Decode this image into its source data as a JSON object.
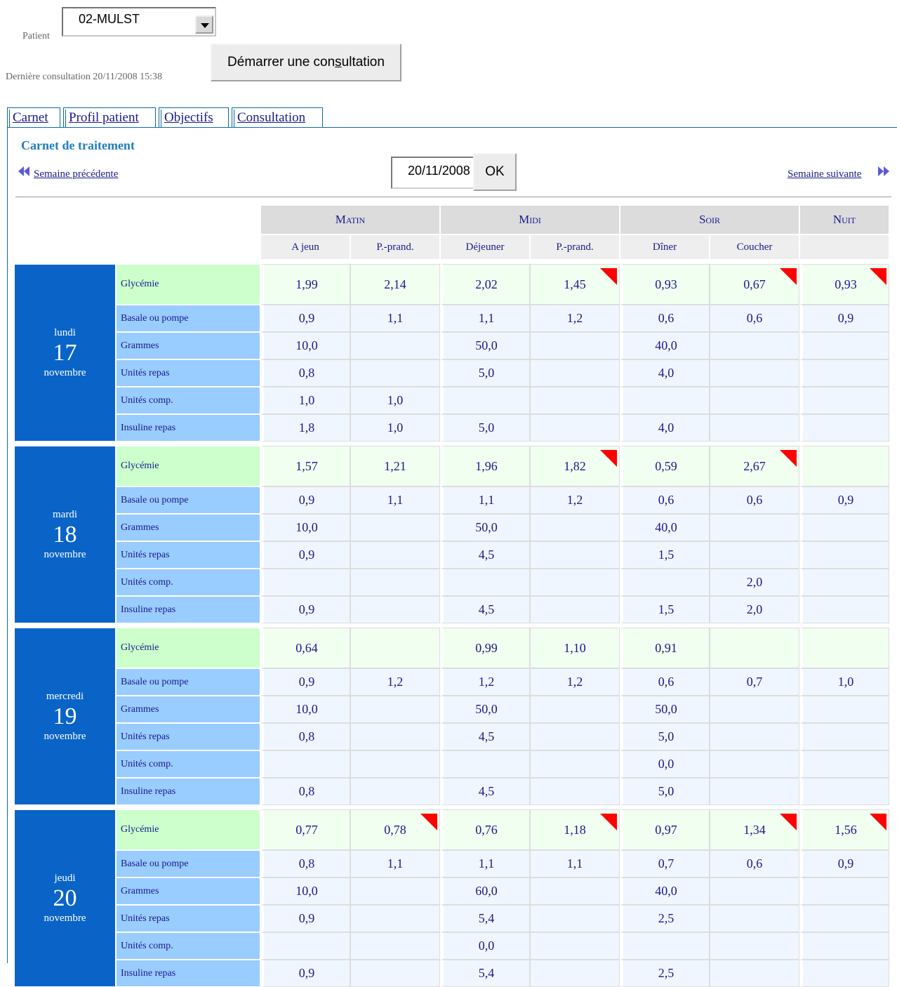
{
  "header": {
    "patient_label": "Patient",
    "patient_value": "02-MULST",
    "last_consultation": "Dernière consultation 20/11/2008 15:38",
    "start_button": "Démarrer une consultation"
  },
  "tabs": [
    "Carnet",
    "Profil patient",
    "Objectifs",
    "Consultation"
  ],
  "carnet": {
    "title": "Carnet de traitement",
    "prev_week": "Semaine précédente",
    "next_week": "Semaine suivante",
    "date_value": "20/11/2008",
    "ok_label": "OK"
  },
  "columns": {
    "groups": [
      "Matin",
      "Midi",
      "Soir",
      "Nuit"
    ],
    "subs": [
      "A jeun",
      "P.-prand.",
      "Déjeuner",
      "P.-prand.",
      "Dîner",
      "Coucher",
      ""
    ]
  },
  "row_labels": [
    "Glycémie",
    "Basale ou pompe",
    "Grammes",
    "Unités repas",
    "Unités comp.",
    "Insuline repas"
  ],
  "colors": {
    "day": "#0a64c8",
    "flag": "#ff0000",
    "glyc_label": "#ccffcc",
    "row_label": "#99ccff"
  },
  "days": [
    {
      "name": "lundi",
      "num": "17",
      "month": "novembre",
      "rows": [
        [
          "1,99",
          "2,14",
          "2,02",
          "1,45",
          "0,93",
          "0,67",
          "0,93"
        ],
        [
          "0,9",
          "1,1",
          "1,1",
          "1,2",
          "0,6",
          "0,6",
          "0,9"
        ],
        [
          "10,0",
          "",
          "50,0",
          "",
          "40,0",
          "",
          ""
        ],
        [
          "0,8",
          "",
          "5,0",
          "",
          "4,0",
          "",
          ""
        ],
        [
          "1,0",
          "1,0",
          "",
          "",
          "",
          "",
          ""
        ],
        [
          "1,8",
          "1,0",
          "5,0",
          "",
          "4,0",
          "",
          ""
        ]
      ],
      "flags": [
        false,
        false,
        false,
        true,
        false,
        true,
        true
      ]
    },
    {
      "name": "mardi",
      "num": "18",
      "month": "novembre",
      "rows": [
        [
          "1,57",
          "1,21",
          "1,96",
          "1,82",
          "0,59",
          "2,67",
          ""
        ],
        [
          "0,9",
          "1,1",
          "1,1",
          "1,2",
          "0,6",
          "0,6",
          "0,9"
        ],
        [
          "10,0",
          "",
          "50,0",
          "",
          "40,0",
          "",
          ""
        ],
        [
          "0,9",
          "",
          "4,5",
          "",
          "1,5",
          "",
          ""
        ],
        [
          "",
          "",
          "",
          "",
          "",
          "2,0",
          ""
        ],
        [
          "0,9",
          "",
          "4,5",
          "",
          "1,5",
          "2,0",
          ""
        ]
      ],
      "flags": [
        false,
        false,
        false,
        true,
        false,
        true,
        false
      ]
    },
    {
      "name": "mercredi",
      "num": "19",
      "month": "novembre",
      "rows": [
        [
          "0,64",
          "",
          "0,99",
          "1,10",
          "0,91",
          "",
          ""
        ],
        [
          "0,9",
          "1,2",
          "1,2",
          "1,2",
          "0,6",
          "0,7",
          "1,0"
        ],
        [
          "10,0",
          "",
          "50,0",
          "",
          "50,0",
          "",
          ""
        ],
        [
          "0,8",
          "",
          "4,5",
          "",
          "5,0",
          "",
          ""
        ],
        [
          "",
          "",
          "",
          "",
          "0,0",
          "",
          ""
        ],
        [
          "0,8",
          "",
          "4,5",
          "",
          "5,0",
          "",
          ""
        ]
      ],
      "flags": [
        false,
        false,
        false,
        false,
        false,
        false,
        false
      ]
    },
    {
      "name": "jeudi",
      "num": "20",
      "month": "novembre",
      "rows": [
        [
          "0,77",
          "0,78",
          "0,76",
          "1,18",
          "0,97",
          "1,34",
          "1,56"
        ],
        [
          "0,8",
          "1,1",
          "1,1",
          "1,1",
          "0,7",
          "0,6",
          "0,9"
        ],
        [
          "10,0",
          "",
          "60,0",
          "",
          "40,0",
          "",
          ""
        ],
        [
          "0,9",
          "",
          "5,4",
          "",
          "2,5",
          "",
          ""
        ],
        [
          "",
          "",
          "0,0",
          "",
          "",
          "",
          ""
        ],
        [
          "0,9",
          "",
          "5,4",
          "",
          "2,5",
          "",
          ""
        ]
      ],
      "flags": [
        false,
        true,
        false,
        true,
        false,
        true,
        true
      ]
    }
  ]
}
